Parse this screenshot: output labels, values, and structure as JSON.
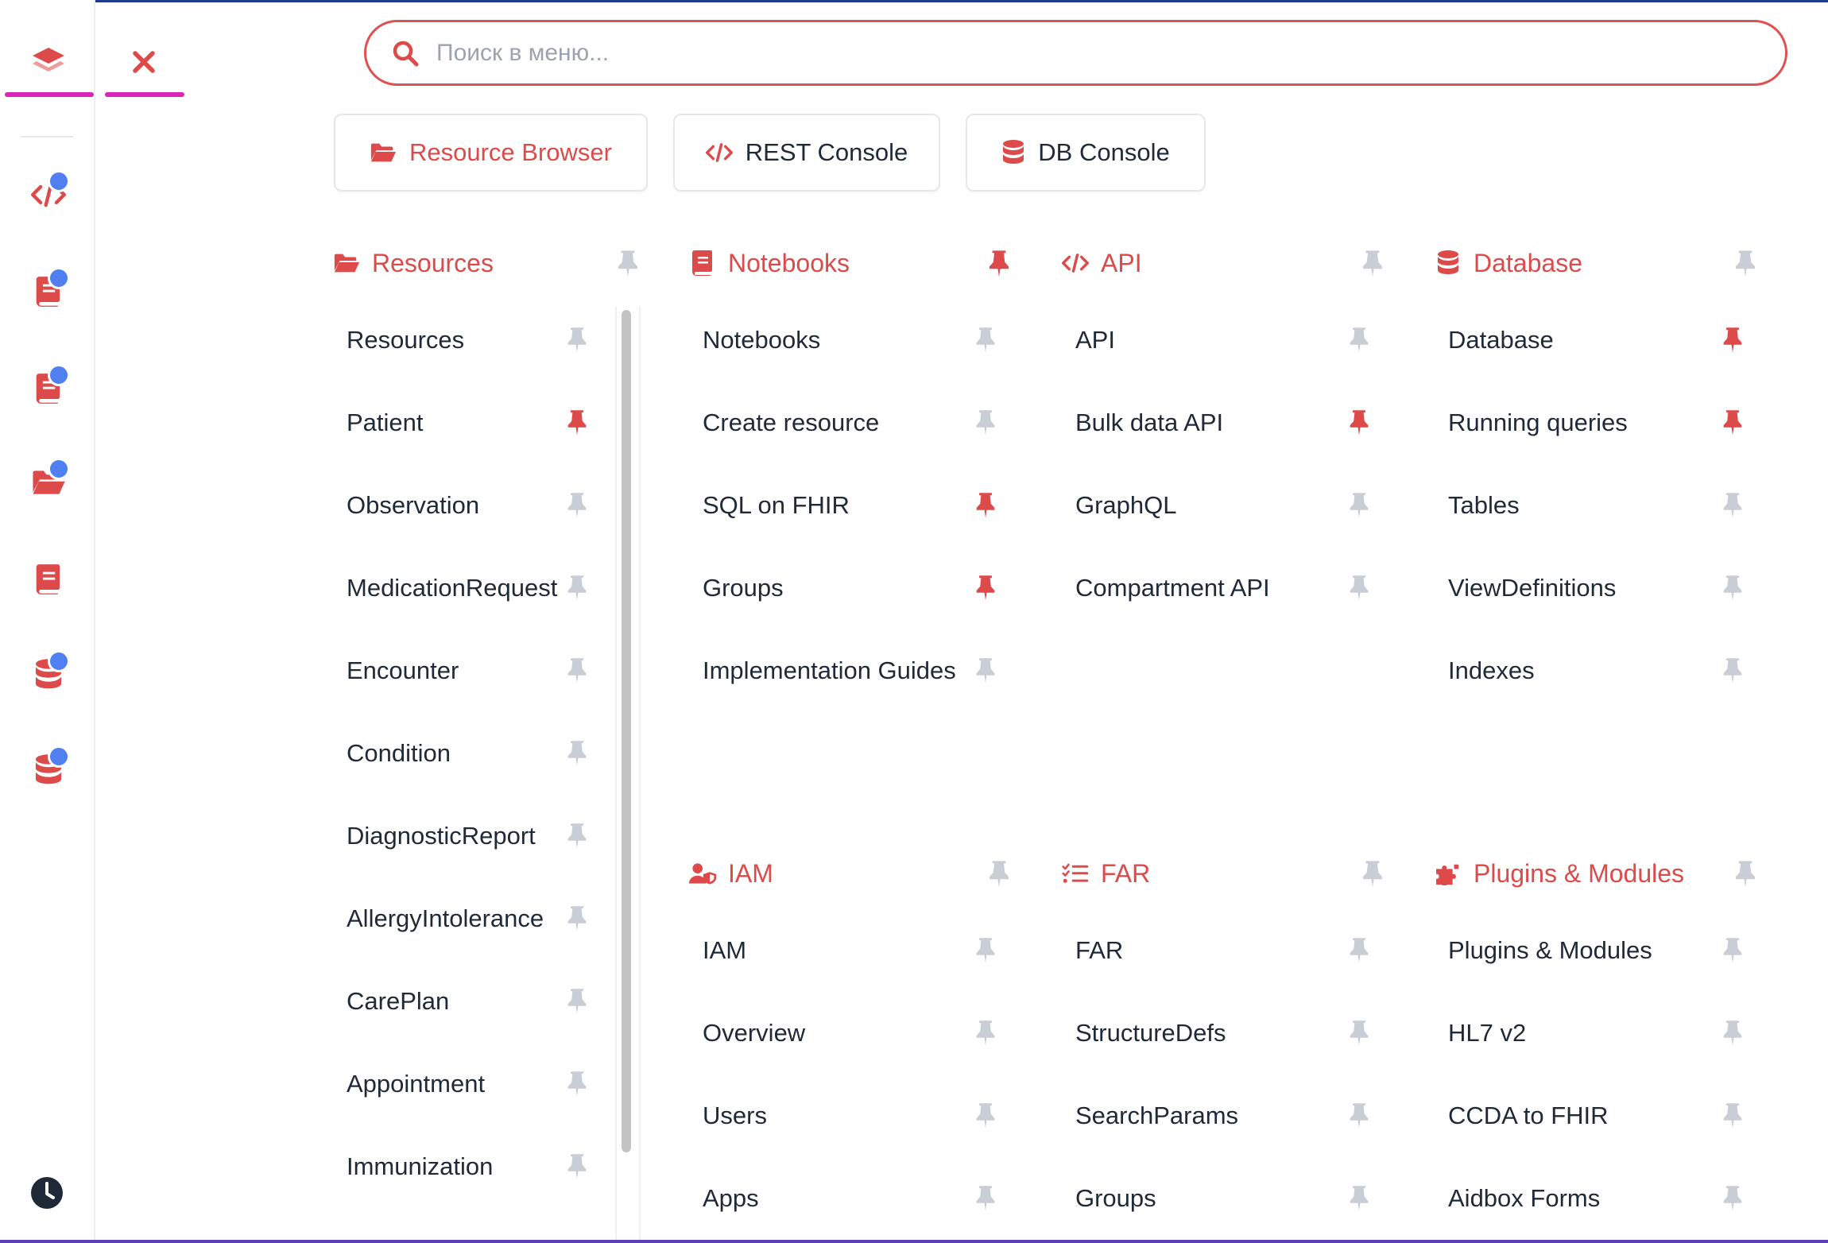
{
  "colors": {
    "accent": "#dc4a4a",
    "rail_dot": "#4f7ff0",
    "underline": "#d926b6",
    "pin_inactive": "#c9ced6"
  },
  "search": {
    "placeholder": "Поиск в меню..."
  },
  "quick_buttons": [
    {
      "label": "Resource Browser",
      "icon": "folder-open-icon"
    },
    {
      "label": "REST Console",
      "icon": "code-icon"
    },
    {
      "label": "DB Console",
      "icon": "database-icon"
    }
  ],
  "rail": {
    "icons": [
      "code-icon",
      "notebook-icon",
      "notebook-icon",
      "folder-open-icon",
      "book-icon",
      "database-icon",
      "database-icon"
    ]
  },
  "sections": {
    "resources": {
      "title": "Resources",
      "icon": "folder-open-icon",
      "pinned": false,
      "items": [
        {
          "label": "Resources",
          "pinned": false
        },
        {
          "label": "Patient",
          "pinned": true
        },
        {
          "label": "Observation",
          "pinned": false
        },
        {
          "label": "MedicationRequest",
          "pinned": false
        },
        {
          "label": "Encounter",
          "pinned": false
        },
        {
          "label": "Condition",
          "pinned": false
        },
        {
          "label": "DiagnosticReport",
          "pinned": false
        },
        {
          "label": "AllergyIntolerance",
          "pinned": false
        },
        {
          "label": "CarePlan",
          "pinned": false
        },
        {
          "label": "Appointment",
          "pinned": false
        },
        {
          "label": "Immunization",
          "pinned": false
        }
      ]
    },
    "notebooks": {
      "title": "Notebooks",
      "icon": "notebook-icon",
      "pinned": true,
      "items": [
        {
          "label": "Notebooks",
          "pinned": false
        },
        {
          "label": "Create resource",
          "pinned": false
        },
        {
          "label": "SQL on FHIR",
          "pinned": true
        },
        {
          "label": "Groups",
          "pinned": true
        },
        {
          "label": "Implementation Guides",
          "pinned": false
        }
      ]
    },
    "api": {
      "title": "API",
      "icon": "code-icon",
      "pinned": false,
      "items": [
        {
          "label": "API",
          "pinned": false
        },
        {
          "label": "Bulk data API",
          "pinned": true
        },
        {
          "label": "GraphQL",
          "pinned": false
        },
        {
          "label": "Compartment API",
          "pinned": false
        }
      ]
    },
    "database": {
      "title": "Database",
      "icon": "database-icon",
      "pinned": false,
      "items": [
        {
          "label": "Database",
          "pinned": true
        },
        {
          "label": "Running queries",
          "pinned": true
        },
        {
          "label": "Tables",
          "pinned": false
        },
        {
          "label": "ViewDefinitions",
          "pinned": false
        },
        {
          "label": "Indexes",
          "pinned": false
        }
      ]
    },
    "iam": {
      "title": "IAM",
      "icon": "user-shield-icon",
      "pinned": false,
      "items": [
        {
          "label": "IAM",
          "pinned": false
        },
        {
          "label": "Overview",
          "pinned": false
        },
        {
          "label": "Users",
          "pinned": false
        },
        {
          "label": "Apps",
          "pinned": false
        }
      ]
    },
    "far": {
      "title": "FAR",
      "icon": "list-check-icon",
      "pinned": false,
      "items": [
        {
          "label": "FAR",
          "pinned": false
        },
        {
          "label": "StructureDefs",
          "pinned": false
        },
        {
          "label": "SearchParams",
          "pinned": false
        },
        {
          "label": "Groups",
          "pinned": false
        }
      ]
    },
    "plugins": {
      "title": "Plugins & Modules",
      "icon": "puzzle-icon",
      "pinned": false,
      "items": [
        {
          "label": "Plugins & Modules",
          "pinned": false
        },
        {
          "label": "HL7 v2",
          "pinned": false
        },
        {
          "label": "CCDA to FHIR",
          "pinned": false
        },
        {
          "label": "Aidbox Forms",
          "pinned": false
        }
      ]
    }
  }
}
